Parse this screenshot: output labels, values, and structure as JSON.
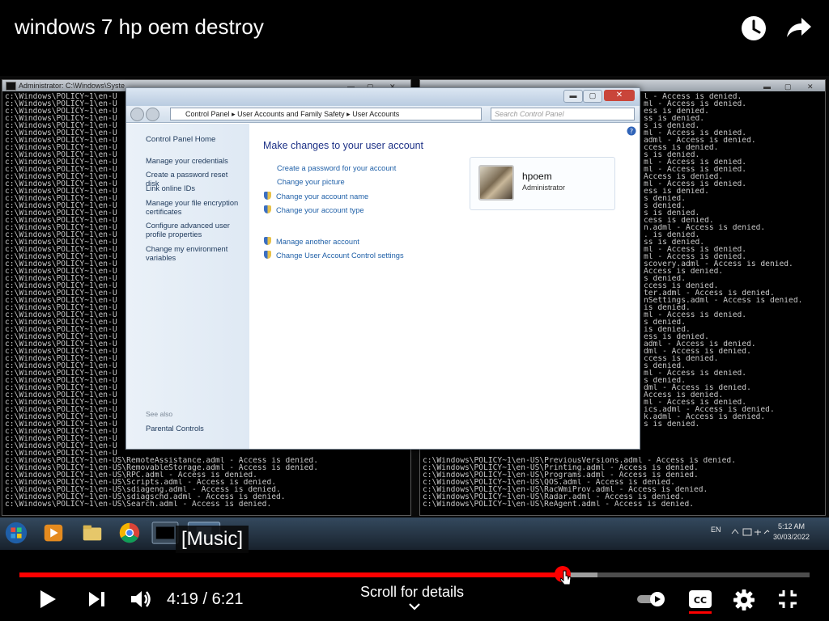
{
  "video": {
    "title": "windows 7 hp oem destroy",
    "caption": "[Music]",
    "time_current": "4:19",
    "time_separator": "/",
    "time_total": "6:21",
    "progress_fraction": 0.687,
    "buffer_fraction": 0.732,
    "details_label": "Scroll for details",
    "accent_color": "#ff0000"
  },
  "icons": {
    "watch_later": "clock-icon",
    "share": "share-arrow-icon",
    "play": "play-icon",
    "next": "next-icon",
    "volume": "volume-icon",
    "autoplay": "autoplay-toggle-icon",
    "captions": "cc-icon",
    "settings": "gear-icon",
    "fullscreen": "fullscreen-exit-icon"
  },
  "screen": {
    "cmd_left": {
      "title": "Administrator: C:\\Windows\\Syste",
      "bottom_lines": [
        "c:\\Windows\\POLICY~1\\en-US\\RemoteAssistance.adml - Access is denied.",
        "c:\\Windows\\POLICY~1\\en-US\\RemovableStorage.adml - Access is denied.",
        "c:\\Windows\\POLICY~1\\en-US\\RPC.adml - Access is denied.",
        "c:\\Windows\\POLICY~1\\en-US\\Scripts.adml - Access is denied.",
        "c:\\Windows\\POLICY~1\\en-US\\sdiageng.adml - Access is denied.",
        "c:\\Windows\\POLICY~1\\en-US\\sdiagschd.adml - Access is denied.",
        "c:\\Windows\\POLICY~1\\en-US\\Search.adml - Access is denied."
      ]
    },
    "cmd_right": {
      "lines": [
        "l - Access is denied.",
        "ml - Access is denied.",
        "ess is denied.",
        "ss is denied.",
        "s is denied.",
        "ml - Access is denied.",
        "adml - Access is denied.",
        "ccess is denied.",
        "s is denied.",
        "ml - Access is denied.",
        "ml - Access is denied.",
        "Access is denied.",
        "ml - Access is denied.",
        "ess is denied.",
        "s denied.",
        "s denied.",
        "s is denied.",
        "cess is denied.",
        "n.adml - Access is denied.",
        ". is denied.",
        "ss is denied.",
        "ml - Access is denied.",
        "ml - Access is denied.",
        "scovery.adml - Access is denied.",
        "Access is denied.",
        "s denied.",
        "ccess is denied.",
        "ter.adml - Access is denied.",
        "nSettings.adml - Access is denied.",
        "is denied.",
        "ml - Access is denied.",
        "s denied.",
        "is denied.",
        "ess is denied.",
        "adml - Access is denied.",
        "dml - Access is denied.",
        "ccess is denied.",
        "s denied.",
        "ml - Access is denied.",
        "s denied.",
        "dml - Access is denied.",
        "Access is denied.",
        "ml - Access is denied.",
        "ics.adml - Access is denied.",
        "k.adml - Access is denied.",
        "s is denied."
      ],
      "bottom_lines": [
        "c:\\Windows\\POLICY~1\\en-US\\PreviousVersions.adml - Access is denied.",
        "c:\\Windows\\POLICY~1\\en-US\\Printing.adml - Access is denied.",
        "c:\\Windows\\POLICY~1\\en-US\\Programs.adml - Access is denied.",
        "c:\\Windows\\POLICY~1\\en-US\\QOS.adml - Access is denied.",
        "c:\\Windows\\POLICY~1\\en-US\\RacWmiProv.adml - Access is denied.",
        "c:\\Windows\\POLICY~1\\en-US\\Radar.adml - Access is denied.",
        "c:\\Windows\\POLICY~1\\en-US\\ReAgent.adml - Access is denied."
      ]
    },
    "cmd_prefix": "c:\\Windows\\POLICY~1\\en-U",
    "control_panel": {
      "breadcrumb": [
        "Control Panel",
        "User Accounts and Family Safety",
        "User Accounts"
      ],
      "search_placeholder": "Search Control Panel",
      "sidebar": {
        "home": "Control Panel Home",
        "links": [
          "Manage your credentials",
          "Create a password reset disk",
          "Link online IDs",
          "Manage your file encryption certificates",
          "Configure advanced user profile properties",
          "Change my environment variables"
        ],
        "see_also_label": "See also",
        "see_also": "Parental Controls"
      },
      "heading": "Make changes to your user account",
      "tasks": [
        "Create a password for your account",
        "Change your picture",
        "Change your account name",
        "Change your account type"
      ],
      "tasks2": [
        "Manage another account",
        "Change User Account Control settings"
      ],
      "user": {
        "name": "hpoem",
        "role": "Administrator"
      }
    },
    "taskbar": {
      "language": "EN",
      "time": "5:12 AM",
      "date": "30/03/2022"
    }
  }
}
